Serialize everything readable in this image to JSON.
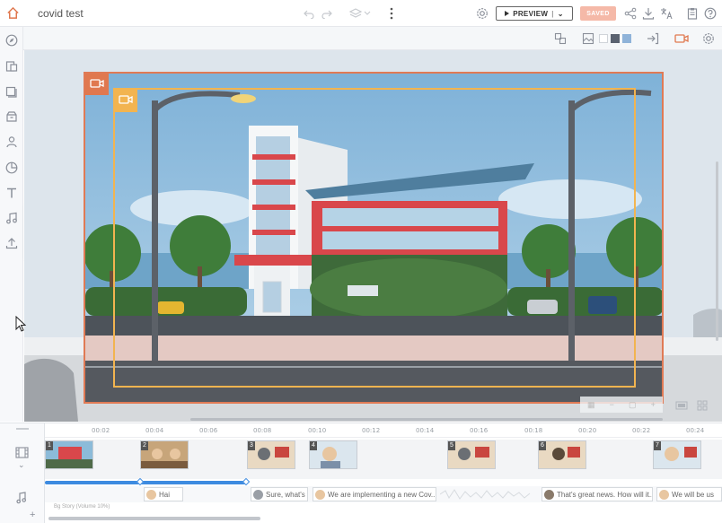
{
  "app": {
    "title": "covid test",
    "preview_label": "PREVIEW",
    "saved_label": "SAVED"
  },
  "colors": {
    "accent": "#e0784f",
    "frame_inner": "#f2b450",
    "saved_bg": "#f5b9a8",
    "audio_bar": "#3d8be0"
  },
  "topbar_icons": [
    "home-icon",
    "undo-icon",
    "redo-icon",
    "layers-icon",
    "more-icon",
    "settings-icon",
    "play-icon",
    "share-icon",
    "download-icon",
    "translate-icon",
    "clipboard-icon",
    "help-icon"
  ],
  "sidebar_icons": [
    "compass-icon",
    "scene-icon",
    "media-icon",
    "props-icon",
    "character-icon",
    "chart-icon",
    "text-icon",
    "music-icon",
    "upload-icon"
  ],
  "subtoolbar_icons": [
    "swap-icon",
    "background-icon",
    "enter-icon",
    "camera-icon",
    "gear-icon"
  ],
  "swatches": [
    "#ffffff",
    "#5a6270",
    "#8fb3d9"
  ],
  "timeline": {
    "ticks": [
      "00:02",
      "00:04",
      "00:06",
      "00:08",
      "00:10",
      "00:12",
      "00:14",
      "00:16",
      "00:18",
      "00:20",
      "00:22",
      "00:24"
    ],
    "scenes": [
      "1",
      "2",
      "3",
      "4",
      "5",
      "6",
      "7"
    ],
    "dialogs": [
      "Hai",
      "Sure, what's",
      "We are implementing a new Cov...",
      "That's great news. How will it...",
      "We will be us"
    ],
    "music_label": "Bg Story (Volume 10%)"
  }
}
